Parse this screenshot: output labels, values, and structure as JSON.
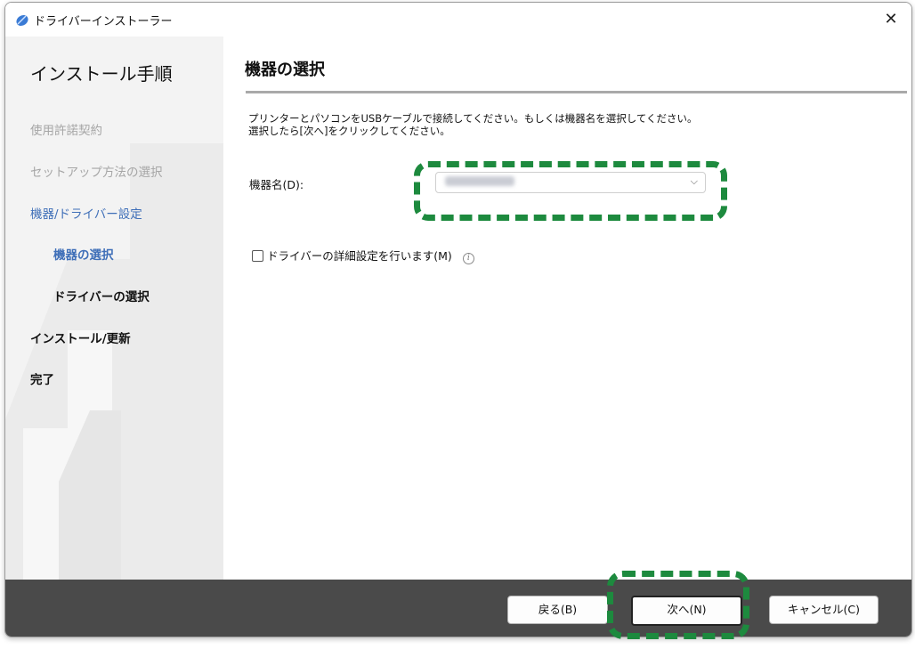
{
  "window": {
    "title": "ドライバーインストーラー",
    "close_glyph": "✕",
    "app_icon": "pen-logo-icon"
  },
  "sidebar": {
    "heading": "インストール手順",
    "steps": [
      {
        "label": "使用許諾契約",
        "state": "done"
      },
      {
        "label": "セットアップ方法の選択",
        "state": "done"
      },
      {
        "label": "機器/ドライバー設定",
        "state": "current-group"
      },
      {
        "label": "機器の選択",
        "state": "active"
      },
      {
        "label": "ドライバーの選択",
        "state": "pending"
      },
      {
        "label": "インストール/更新",
        "state": "pending"
      },
      {
        "label": "完了",
        "state": "pending"
      }
    ]
  },
  "content": {
    "title": "機器の選択",
    "description_line1": "プリンターとパソコンをUSBケーブルで接続してください。もしくは機器名を選択してください。",
    "description_line2": "選択したら[次へ]をクリックしてください。",
    "device_label": "機器名(D):",
    "device_select_value": "",
    "advanced_checkbox_label": "ドライバーの詳細設定を行います(M)",
    "advanced_checkbox_checked": false,
    "info_glyph": "i"
  },
  "footer": {
    "back_label": "戻る(B)",
    "next_label": "次へ(N)",
    "cancel_label": "キャンセル(C)"
  },
  "colors": {
    "accent_blue": "#3f6fb8",
    "highlight_green": "#1d8a3e",
    "footer_bg": "#4a4a4a",
    "sidebar_bg": "#f3f3f3"
  }
}
